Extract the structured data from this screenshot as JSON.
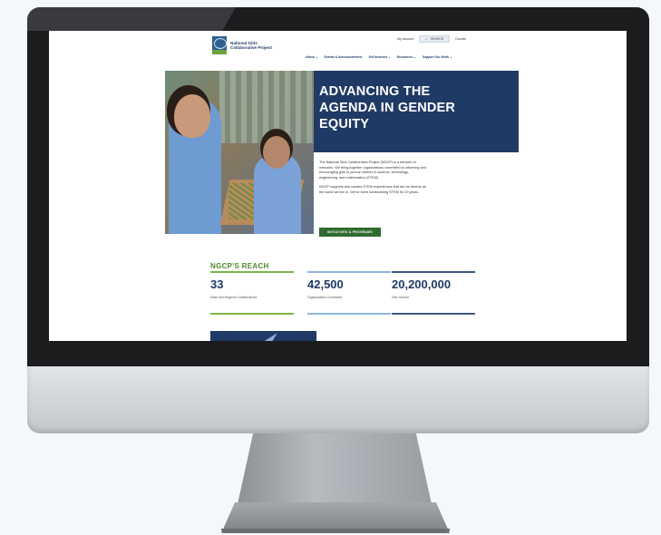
{
  "site": {
    "logo_text": "National Girls Collaborative Project",
    "logo_badge": "NGCP",
    "utility_nav": {
      "account": "My account",
      "search_label": "SEARCH",
      "donate": "Donate"
    },
    "main_nav": [
      {
        "label": "About ⌄"
      },
      {
        "label": "Events & Announcements"
      },
      {
        "label": "Get Involved ⌄"
      },
      {
        "label": "Resources ⌄"
      },
      {
        "label": "Support Our Work ⌄"
      }
    ],
    "hero": {
      "title": "ADVANCING THE AGENDA IN GENDER EQUITY",
      "paragraph_1": "The National Girls Collaborative Project (NGCP) is a network of networks. We bring together organizations committed to informing and encouraging girls to pursue careers in science, technology, engineering, and mathematics (STEM).",
      "paragraph_2": "NGCP supports and curates STEM experiences that are as diverse as the world we live in. We've been transforming STEM for 20 years.",
      "cta_label": "INITIATIVES & PROGRAMS"
    },
    "reach": {
      "title": "NGCP'S REACH",
      "stats": [
        {
          "value": "33",
          "label": "State and Regional Collaboratives"
        },
        {
          "value": "42,500",
          "label": "Organizations Connected"
        },
        {
          "value": "20,200,000",
          "label": "Girls Served"
        }
      ]
    },
    "colors": {
      "navy": "#1f3a64",
      "green": "#2f6b2f",
      "accent_green": "#7ab648",
      "light_blue": "#8ab6de"
    }
  }
}
